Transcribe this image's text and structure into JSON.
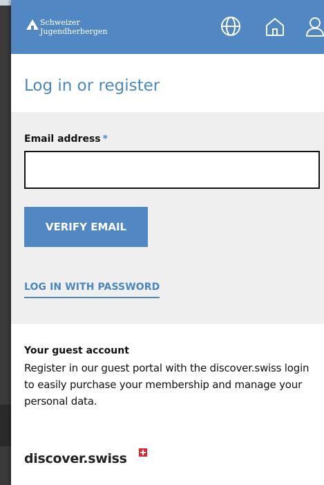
{
  "header": {
    "logo_line1": "Schweizer",
    "logo_line2": "Jugendherbergen",
    "logo_mark_icon": "house-triangle-icon",
    "icons": [
      "globe-icon",
      "home-icon",
      "user-icon"
    ],
    "bg_color": "#5187c3"
  },
  "page": {
    "title": "Log in or register"
  },
  "form": {
    "email_label": "Email address",
    "required_mark": "*",
    "email_value": "",
    "verify_button": "VERIFY EMAIL",
    "password_link": "LOG IN WITH PASSWORD"
  },
  "guest": {
    "title": "Your guest account",
    "text": "Register in our guest portal with the discover.swiss login to easily purchase your membership and manage your personal data.",
    "brand_logo": "discover.swiss"
  },
  "colors": {
    "accent": "#4a86c2",
    "form_bg": "#efefef",
    "swiss_red": "#e3262b"
  }
}
